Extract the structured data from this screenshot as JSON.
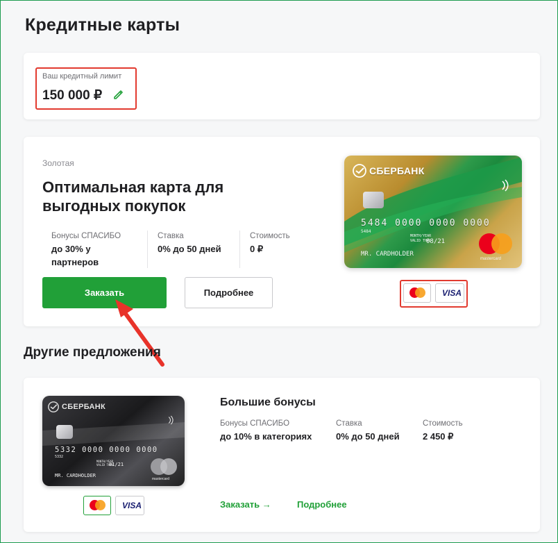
{
  "page": {
    "title": "Кредитные карты"
  },
  "limit": {
    "label": "Ваш кредитный лимит",
    "value": "150 000 ₽"
  },
  "main_offer": {
    "tier": "Золотая",
    "title": "Оптимальная карта для выгодных покупок",
    "stats": [
      {
        "label": "Бонусы СПАСИБО",
        "value": "до 30% у партнеров"
      },
      {
        "label": "Ставка",
        "value": "0% до 50 дней"
      },
      {
        "label": "Стоимость",
        "value": "0 ₽"
      }
    ],
    "order_label": "Заказать",
    "more_label": "Подробнее",
    "card": {
      "bank": "СБЕРБАНК",
      "number": "5484 0000 0000 0000",
      "prefix": "5484",
      "month_year": "MONTH/YEAR",
      "valid_thru": "VALID THRU",
      "expiry": "08/21",
      "holder": "MR. CARDHOLDER",
      "brand": "mastercard"
    },
    "payment_systems": [
      "Mastercard",
      "VISA"
    ]
  },
  "other_section": {
    "title": "Другие предложения"
  },
  "other_offer": {
    "title": "Большие бонусы",
    "stats": [
      {
        "label": "Бонусы СПАСИБО",
        "value": "до 10% в категориях"
      },
      {
        "label": "Ставка",
        "value": "0% до 50 дней"
      },
      {
        "label": "Стоимость",
        "value": "2 450 ₽"
      }
    ],
    "order_label": "Заказать →",
    "more_label": "Подробнее",
    "card": {
      "bank": "СБЕРБАНК",
      "number": "5332 0000 0000 0000",
      "prefix": "5332",
      "month_year": "MONTH/YEAR",
      "valid_thru": "VALID THRU",
      "expiry": "01/21",
      "holder": "MR. CARDHOLDER",
      "brand": "mastercard"
    },
    "payment_systems": [
      "Mastercard",
      "VISA"
    ]
  },
  "colors": {
    "accent": "#21a038",
    "highlight": "#e23a2f",
    "title": "#1f1f22"
  }
}
